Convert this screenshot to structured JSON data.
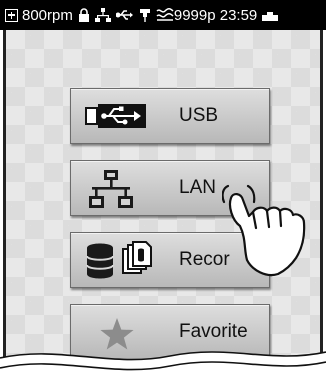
{
  "status_bar": {
    "speed": "800rpm",
    "status_tail": "9999p 23:59",
    "icons": [
      "add-box-icon",
      "lock-icon",
      "lan-icon",
      "usb-icon",
      "pin-icon",
      "thread-icon",
      "battery-icon"
    ]
  },
  "menu": {
    "items": [
      {
        "label": "USB",
        "icon": "usb-icon"
      },
      {
        "label": "LAN",
        "icon": "lan-icon"
      },
      {
        "label": "Recor",
        "icon": "records-icon"
      },
      {
        "label": "Favorite",
        "icon": "star-icon"
      }
    ]
  },
  "colors": {
    "status_bar_bg": "#000000",
    "button_face": "#cccccc",
    "star": "#8c8c8c"
  }
}
